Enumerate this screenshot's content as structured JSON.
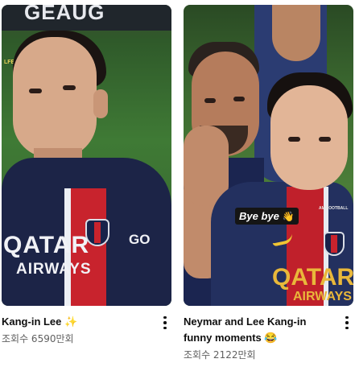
{
  "videos": [
    {
      "title": "Kang-in Lee ✨",
      "views": "조회수 6590만회",
      "thumbnail": {
        "banner_text": "GEAUG",
        "watermark": "LFEV",
        "sponsor_main": "QATAR",
        "sponsor_sub": "AIRWAYS",
        "sleeve_text": "GO"
      }
    },
    {
      "title": "Neymar and Lee Kang-in funny moments 😂",
      "views": "조회수 2122만회",
      "thumbnail": {
        "caption": "Bye bye",
        "caption_emoji": "👋",
        "watermark": "AM FOOTBALL",
        "sponsor_main": "QATAR",
        "sponsor_sub": "AIRWAYS"
      }
    }
  ],
  "icons": {
    "more": "more-vertical-icon",
    "crest": "psg-crest-icon"
  },
  "colors": {
    "title": "#0f0f0f",
    "meta": "#606060",
    "jersey_navy": "#1c2447",
    "jersey_red": "#c8232d"
  }
}
